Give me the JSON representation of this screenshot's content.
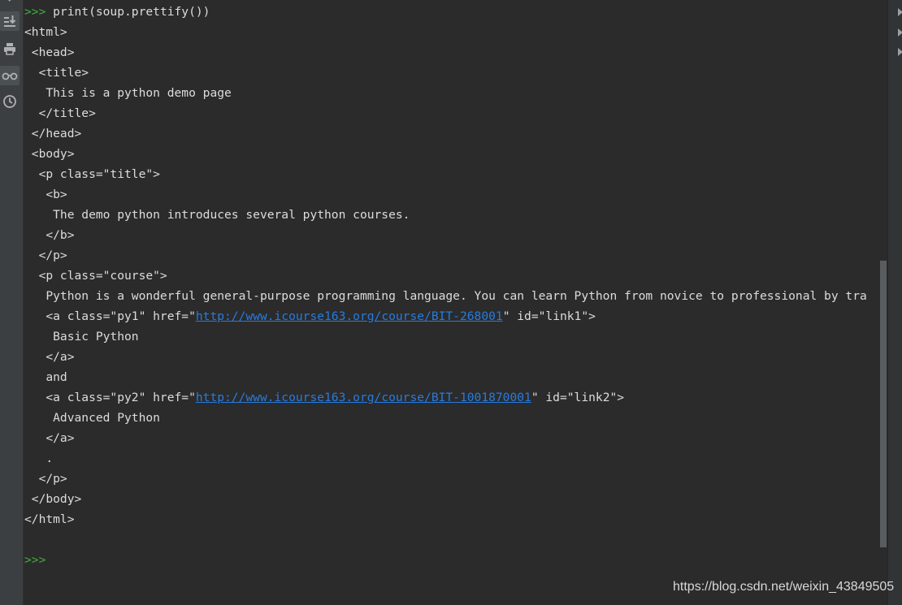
{
  "toolbar": {
    "icons": [
      "rerun-icon",
      "scroll-to-end-icon",
      "print-icon",
      "show-variables-icon",
      "history-icon"
    ]
  },
  "console": {
    "prompt": ">>>",
    "command": " print(soup.prettify())",
    "output": [
      "<html>",
      " <head>",
      "  <title>",
      "   This is a python demo page",
      "  </title>",
      " </head>",
      " <body>",
      "  <p class=\"title\">",
      "   <b>",
      "    The demo python introduces several python courses.",
      "   </b>",
      "  </p>",
      "  <p class=\"course\">",
      "   Python is a wonderful general-purpose programming language. You can learn Python from novice to professional by tra"
    ],
    "link1": {
      "prefix": "   <a class=\"py1\" href=\"",
      "url": "http://www.icourse163.org/course/BIT-268001",
      "suffix": "\" id=\"link1\">"
    },
    "output2": [
      "    Basic Python",
      "   </a>",
      "   and"
    ],
    "link2": {
      "prefix": "   <a class=\"py2\" href=\"",
      "url": "http://www.icourse163.org/course/BIT-1001870001",
      "suffix": "\" id=\"link2\">"
    },
    "output3": [
      "    Advanced Python",
      "   </a>",
      "   .",
      "  </p>",
      " </body>",
      "</html>"
    ],
    "final_prompt": ">>>"
  },
  "watermark": "https://blog.csdn.net/weixin_43849505",
  "colors": {
    "background": "#2b2b2b",
    "text": "#dcdcdc",
    "prompt": "#3fae3f",
    "link": "#287bde"
  }
}
